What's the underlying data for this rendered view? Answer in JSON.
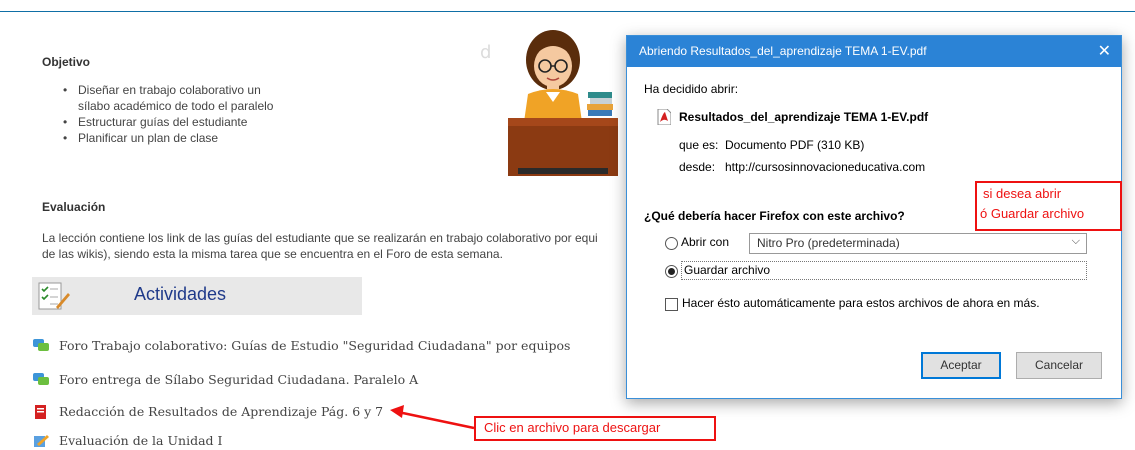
{
  "objective": {
    "heading": "Objetivo",
    "items": [
      "Diseñar en trabajo colaborativo un",
      "sílabo académico de todo el paralelo",
      "Estructurar guías del estudiante",
      "Planificar un plan de clase"
    ]
  },
  "evaluation": {
    "heading": "Evaluación",
    "line1": "La lección contiene los link de las guías del estudiante que se realizarán en trabajo colaborativo por equi",
    "line2": "de las wikis), siendo esta la misma tarea que se encuentra en el Foro de esta semana."
  },
  "activities": {
    "banner_label": "Actividades",
    "items": [
      {
        "label": "Foro Trabajo colaborativo: Guías de Estudio \"Seguridad Ciudadana\" por equipos",
        "icon": "forum-icon"
      },
      {
        "label": "Foro entrega de Sílabo Seguridad Ciudadana. Paralelo A",
        "icon": "forum-icon"
      },
      {
        "label": "Redacción de Resultados de Aprendizaje Pág. 6 y 7",
        "icon": "pdf-icon"
      },
      {
        "label": "Evaluación de la Unidad I",
        "icon": "quiz-icon"
      }
    ]
  },
  "callouts": {
    "download": "Clic en archivo para descargar",
    "open_line1": "si desea abrir",
    "open_line2": "ó Guardar archivo"
  },
  "dialog": {
    "title": "Abriendo Resultados_del_aprendizaje TEMA 1-EV.pdf",
    "close": "✕",
    "decided": "Ha decidido abrir:",
    "filename": "Resultados_del_aprendizaje TEMA 1-EV.pdf",
    "type_label": "que es:",
    "type_value": "Documento PDF (310 KB)",
    "from_label": "desde:",
    "from_value": "http://cursosinnovacioneducativa.com",
    "question": "¿Qué debería hacer Firefox con este archivo?",
    "open_with_label": "Abrir con",
    "open_with_value": "Nitro Pro (predeterminada)",
    "save_label": "Guardar archivo",
    "auto_label": "Hacer ésto automáticamente para estos archivos de ahora en más.",
    "accept": "Aceptar",
    "cancel": "Cancelar"
  },
  "colors": {
    "accent": "#2b83d6",
    "callout": "#e11111",
    "activities_title": "#1f3a8a"
  }
}
